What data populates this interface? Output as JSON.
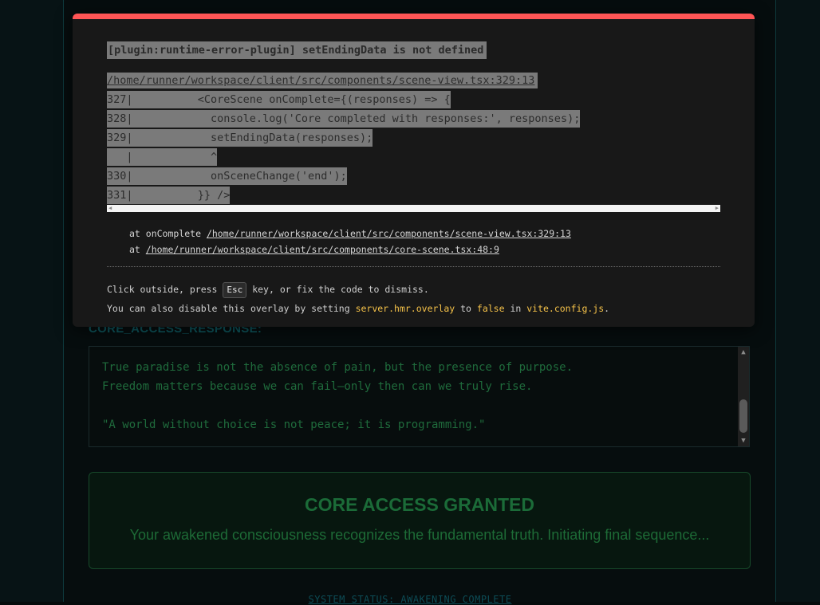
{
  "app": {
    "response_label": "CORE_ACCESS_RESPONSE:",
    "response_lines": [
      "True paradise is not the absence of pain, but the presence of purpose.",
      "Freedom matters because we can fail—only then can we truly rise.",
      "",
      "\"A world without choice is not peace; it is programming.\""
    ],
    "granted_title": "CORE ACCESS GRANTED",
    "granted_message": "Your awakened consciousness recognizes the fundamental truth. Initiating final sequence...",
    "system_status": "SYSTEM STATUS: AWAKENING COMPLETE"
  },
  "overlay": {
    "message": "[plugin:runtime-error-plugin] setEndingData is not defined",
    "file": "/home/runner/workspace/client/src/components/scene-view.tsx:329:13",
    "frame_lines": [
      "327|          <CoreScene onComplete={(responses) => {",
      "328|            console.log('Core completed with responses:', responses);",
      "329|            setEndingData(responses);",
      "   |            ^",
      "330|            onSceneChange('end');",
      "331|          }} />"
    ],
    "stack": [
      {
        "prefix": "at onComplete ",
        "link": "/home/runner/workspace/client/src/components/scene-view.tsx:329:13"
      },
      {
        "prefix": "at ",
        "link": "/home/runner/workspace/client/src/components/core-scene.tsx:48:9"
      }
    ],
    "tip_part1": "Click outside, press ",
    "tip_key": "Esc",
    "tip_part2": " key, or fix the code to dismiss.",
    "tip2_part1": "You can also disable this overlay by setting ",
    "tip2_code1": "server.hmr.overlay",
    "tip2_part2": " to ",
    "tip2_code2": "false",
    "tip2_part3": " in ",
    "tip2_code3": "vite.config.js",
    "tip2_part4": "."
  },
  "colors": {
    "overlay_border": "#ff5555",
    "highlight": "#f5c249",
    "terminal_green": "#1f6b3c",
    "label_teal": "#0e5960"
  }
}
